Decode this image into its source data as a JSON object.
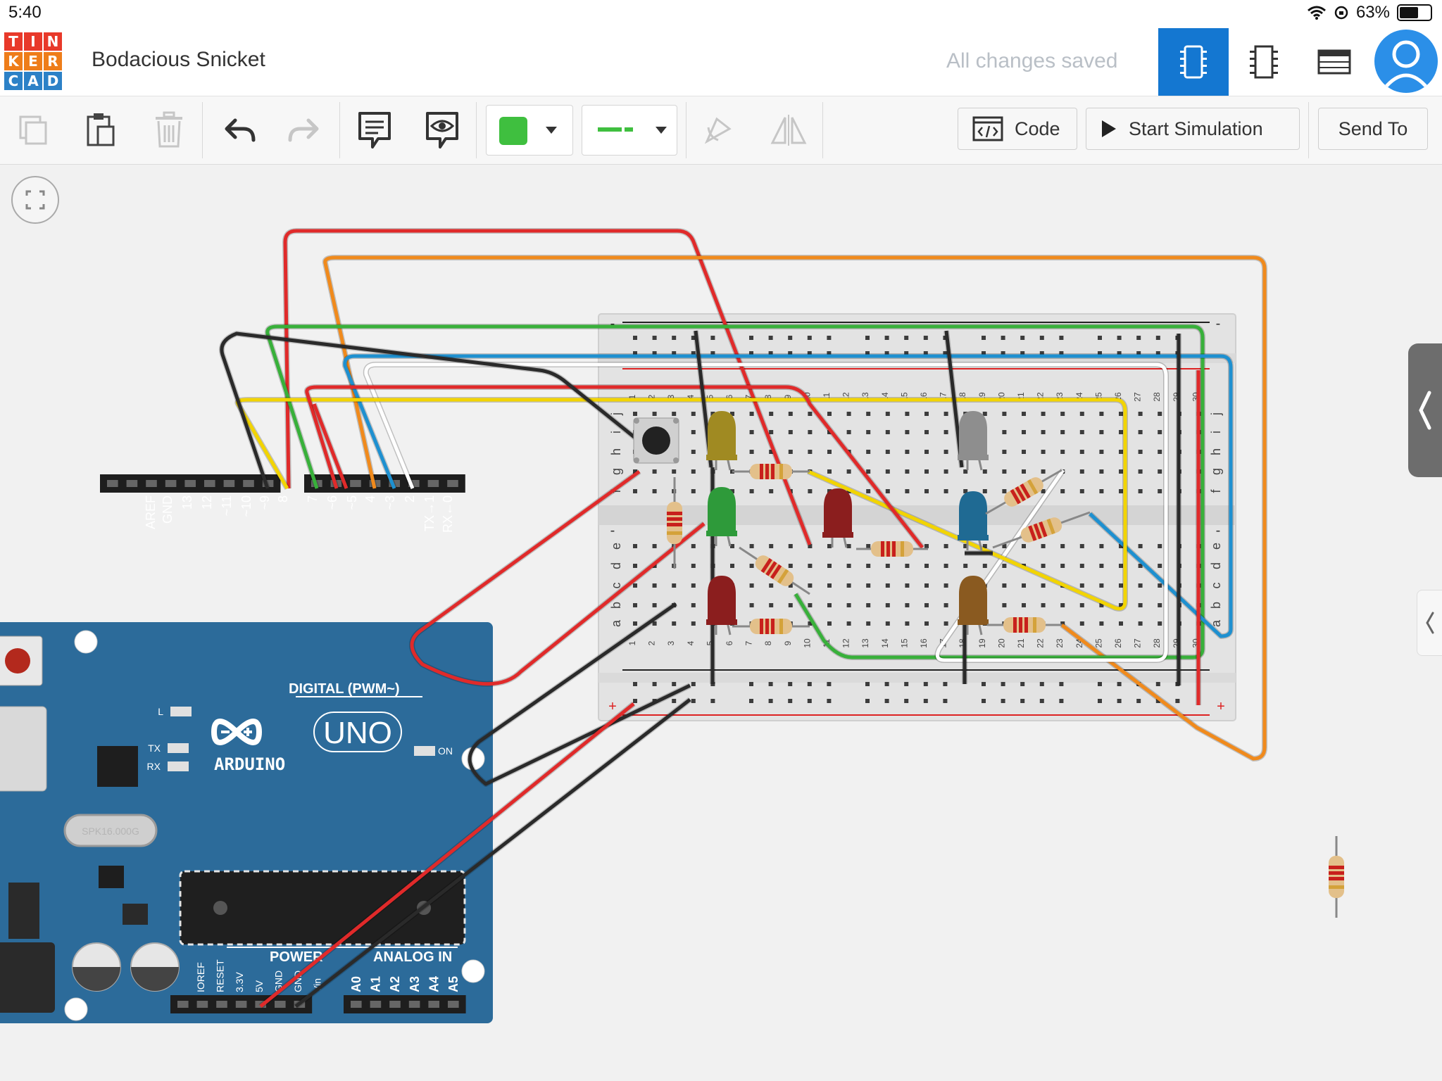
{
  "status": {
    "time": "5:40",
    "battery": "63%"
  },
  "header": {
    "logo_letters": [
      "T",
      "I",
      "N",
      "K",
      "E",
      "R",
      "C",
      "A",
      "D"
    ],
    "logo_colors": [
      "#e8392a",
      "#e8392a",
      "#e8392a",
      "#ee7d1a",
      "#ee7d1a",
      "#ee7d1a",
      "#2c81c7",
      "#2c81c7",
      "#2c81c7"
    ],
    "project_title": "Bodacious Snicket",
    "save_status": "All changes saved",
    "accent_color": "#1477d1"
  },
  "toolbar": {
    "color_swatch": "#3fbf3f",
    "code_label": "Code",
    "start_simulation_label": "Start Simulation",
    "send_to_label": "Send To"
  },
  "arduino": {
    "board_name": "ARDUINO",
    "model": "UNO",
    "digital_label": "DIGITAL (PWM~)",
    "power_label": "POWER",
    "analog_label": "ANALOG IN",
    "crystal_label": "SPK16.000G",
    "digital_pins": [
      "AREF",
      "GND",
      "13",
      "12",
      "~11",
      "~10",
      "~9",
      "8",
      "7",
      "~6",
      "~5",
      "4",
      "~3",
      "2",
      "TX→1",
      "RX←0"
    ],
    "power_pins": [
      "IOREF",
      "RESET",
      "3.3V",
      "5V",
      "GND",
      "GND",
      "Vin"
    ],
    "analog_pins": [
      "A0",
      "A1",
      "A2",
      "A3",
      "A4",
      "A5"
    ],
    "led_labels": [
      "L",
      "TX",
      "RX",
      "ON"
    ],
    "board_color": "#2c6b9a"
  },
  "breadboard": {
    "rows_top": [
      "j",
      "i",
      "h",
      "g",
      "f"
    ],
    "rows_bottom": [
      "e",
      "d",
      "c",
      "b",
      "a"
    ],
    "columns": 30,
    "rail_minus": "-",
    "rail_plus": "+"
  },
  "leds": [
    {
      "color": "#a08a22",
      "label": "yellow led"
    },
    {
      "color": "#2e9a3a",
      "label": "green led"
    },
    {
      "color": "#8b1e1e",
      "label": "red led"
    },
    {
      "color": "#8b1e1e",
      "label": "red led"
    },
    {
      "color": "#8e8e8e",
      "label": "white led"
    },
    {
      "color": "#1f6a93",
      "label": "blue led"
    },
    {
      "color": "#8a5a20",
      "label": "orange led"
    }
  ],
  "wire_colors": {
    "red": "#e02a2a",
    "orange": "#f08a1c",
    "green": "#38b03a",
    "blue": "#1e90d0",
    "yellow": "#f2d400",
    "white": "#ffffff",
    "black": "#2a2a2a"
  }
}
